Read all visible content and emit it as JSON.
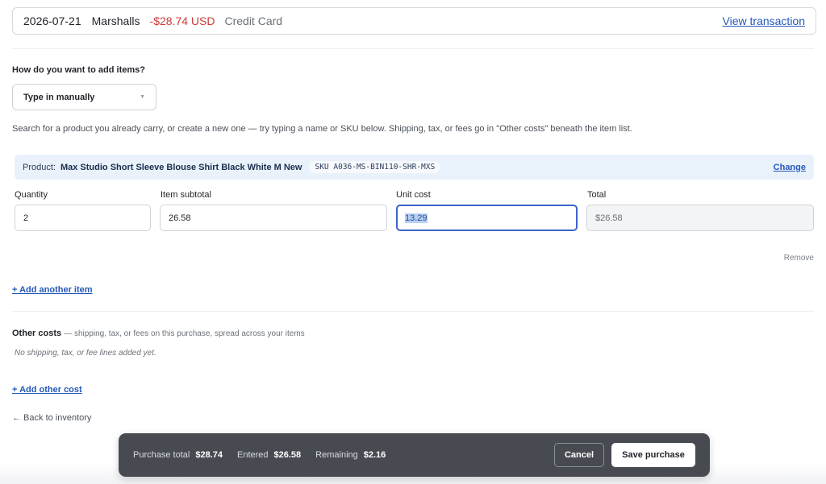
{
  "transaction": {
    "date": "2026-07-21",
    "merchant": "Marshalls",
    "amount": "-$28.74 USD",
    "method": "Credit Card",
    "view_link": "View transaction"
  },
  "add_items": {
    "question": "How do you want to add items?",
    "mode_selected": "Type in manually",
    "help": "Search for a product you already carry, or create a new one — try typing a name or SKU below. Shipping, tax, or fees go in \"Other costs\" beneath the item list."
  },
  "item": {
    "product_prefix": "Product:",
    "product_name": "Max Studio Short Sleeve Blouse Shirt Black White M New",
    "sku": "SKU A036-MS-BIN110-SHR-MXS",
    "change_label": "Change",
    "fields": {
      "quantity_label": "Quantity",
      "quantity_value": "2",
      "subtotal_label": "Item subtotal",
      "subtotal_value": "26.58",
      "unit_cost_label": "Unit cost",
      "unit_cost_value": "13.29",
      "total_label": "Total",
      "total_value": "$26.58"
    },
    "remove_label": "Remove"
  },
  "add_item_label": "+ Add another item",
  "other_costs": {
    "title": "Other costs",
    "description": "— shipping, tax, or fees on this purchase, spread across your items",
    "empty": "No shipping, tax, or fee lines added yet.",
    "add_label": "+ Add other cost"
  },
  "back_label": "← Back to inventory",
  "footer": {
    "purchase_total_label": "Purchase total",
    "purchase_total_value": "$28.74",
    "entered_label": "Entered",
    "entered_value": "$26.58",
    "remaining_label": "Remaining",
    "remaining_value": "$2.16",
    "cancel_label": "Cancel",
    "save_label": "Save purchase"
  },
  "colors": {
    "accent": "#2458b8",
    "negative_amount": "#cf3a3a",
    "product_bar_bg": "#e9f1fb",
    "footer_bg": "#474b51",
    "focus_ring": "#3b63c9"
  }
}
